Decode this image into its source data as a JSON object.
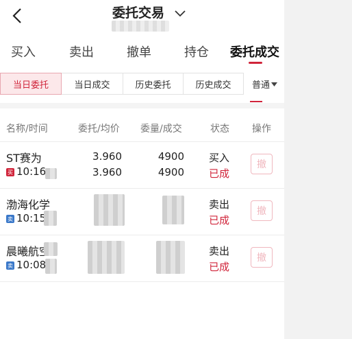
{
  "header": {
    "title": "委托交易",
    "back_icon": "chevron-left-icon",
    "title_dropdown_icon": "chevron-down-icon"
  },
  "main_tabs": [
    {
      "label": "买入"
    },
    {
      "label": "卖出"
    },
    {
      "label": "撤单"
    },
    {
      "label": "持仓"
    },
    {
      "label": "委托成交"
    }
  ],
  "sub_tabs": [
    {
      "label": "当日委托"
    },
    {
      "label": "当日成交"
    },
    {
      "label": "历史委托"
    },
    {
      "label": "历史成交"
    }
  ],
  "mode_select": {
    "value": "普通"
  },
  "table": {
    "headers": [
      "名称/时间",
      "委托/均价",
      "委量/成交",
      "状态",
      "操作"
    ],
    "rows": [
      {
        "name": "ST赛为",
        "side_badge": "买",
        "time": "10:16",
        "order_price": "3.960",
        "avg_price": "3.960",
        "order_qty": "4900",
        "filled_qty": "4900",
        "side": "买入",
        "status": "已成",
        "action": "撤"
      },
      {
        "name": "渤海化学",
        "side_badge": "卖",
        "time": "10:15",
        "order_price": "",
        "avg_price": "",
        "order_qty": "",
        "filled_qty": "",
        "side": "卖出",
        "status": "已成",
        "action": "撤"
      },
      {
        "name": "晨曦航空",
        "side_badge": "卖",
        "time": "10:08:",
        "order_price": "",
        "avg_price": "",
        "order_qty": "",
        "filled_qty": "",
        "side": "卖出",
        "status": "已成",
        "action": "撤"
      }
    ]
  },
  "colors": {
    "accent": "#d0243a",
    "sell_badge": "#3a78c9",
    "panel_bg": "#ffffff",
    "page_bg": "#f2f2f2"
  }
}
